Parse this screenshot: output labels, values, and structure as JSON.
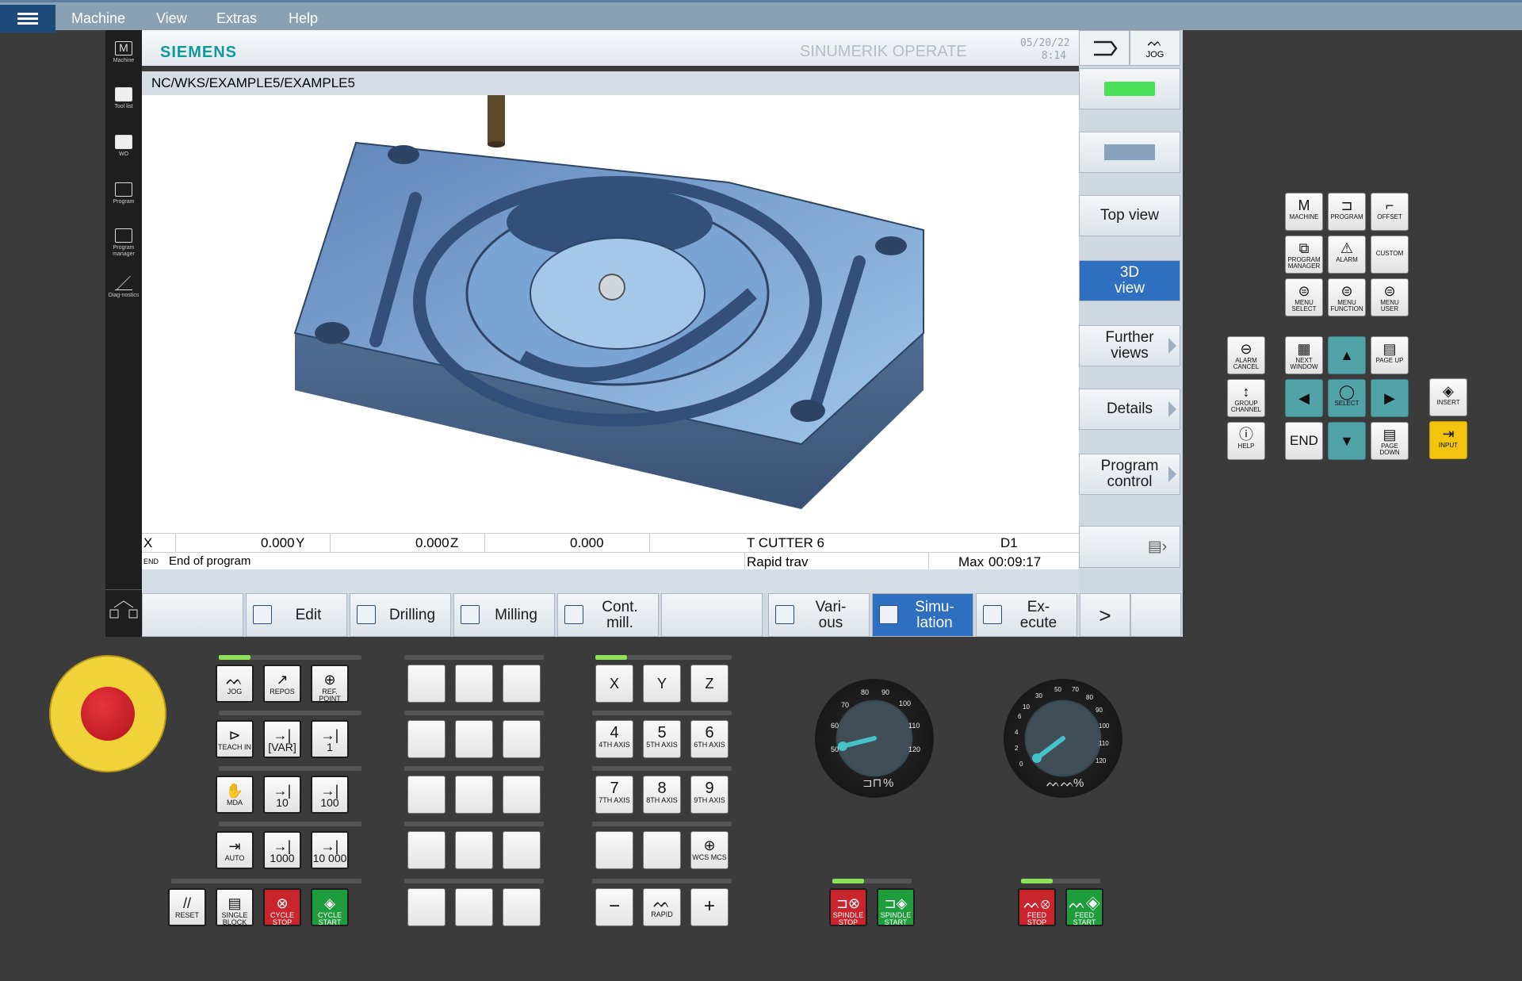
{
  "menu": {
    "items": [
      "Machine",
      "View",
      "Extras",
      "Help"
    ]
  },
  "left_strip": [
    {
      "label": "Machine",
      "icon": "machine-icon"
    },
    {
      "label": "Tool list",
      "icon": "tool-list-icon"
    },
    {
      "label": "WO",
      "icon": "work-offset-icon"
    },
    {
      "label": "Program",
      "icon": "program-icon"
    },
    {
      "label": "Program manager",
      "icon": "program-manager-icon"
    },
    {
      "label": "Diag-nostics",
      "icon": "diagnostics-icon"
    }
  ],
  "header": {
    "brand": "SIEMENS",
    "product": "SINUMERIK OPERATE",
    "date": "05/20/22",
    "time": "8:14",
    "mode_label": "JOG"
  },
  "path": "NC/WKS/EXAMPLE5/EXAMPLE5",
  "status": {
    "x_label": "X",
    "x_value": "0.000",
    "y_label": "Y",
    "y_value": "0.000",
    "z_label": "Z",
    "z_value": "0.000",
    "tool": "T CUTTER 6",
    "d": "D1",
    "end_flag": "END",
    "program_state": "End of program",
    "feed_mode": "Rapid trav",
    "max_label": "Max",
    "max_time": "00:09:17"
  },
  "right_softkeys": [
    {
      "label": "Top view"
    },
    {
      "label": "3D view",
      "active": true
    },
    {
      "label": "Further views",
      "arrow": true
    },
    {
      "label": "Details",
      "arrow": true
    },
    {
      "label": "Program control",
      "arrow": true
    }
  ],
  "bottom_softkeys": [
    {
      "label": ""
    },
    {
      "label": "Edit"
    },
    {
      "label": "Drilling"
    },
    {
      "label": "Milling"
    },
    {
      "label": "Cont. mill."
    },
    {
      "label": ""
    },
    {
      "label": "Vari- ous"
    },
    {
      "label": "Simu- lation",
      "active": true
    },
    {
      "label": "Ex- ecute"
    },
    {
      "label": ">"
    },
    {
      "label": ""
    }
  ],
  "mcp_left": [
    [
      {
        "label": "JOG",
        "glyph": "ᨓ"
      },
      {
        "label": "REPOS",
        "glyph": "↗"
      },
      {
        "label": "REF. POINT",
        "glyph": "⊕"
      }
    ],
    [
      {
        "label": "TEACH IN",
        "glyph": "⊳"
      },
      {
        "label": "[VAR]",
        "glyph": "→|"
      },
      {
        "label": "1",
        "glyph": "→|"
      }
    ],
    [
      {
        "label": "MDA",
        "glyph": "✋"
      },
      {
        "label": "10",
        "glyph": "→|"
      },
      {
        "label": "100",
        "glyph": "→|"
      }
    ],
    [
      {
        "label": "AUTO",
        "glyph": "⇥"
      },
      {
        "label": "1000",
        "glyph": "→|"
      },
      {
        "label": "10 000",
        "glyph": "→|"
      }
    ]
  ],
  "mcp_bottom": [
    {
      "label": "RESET",
      "glyph": "//"
    },
    {
      "label": "SINGLE BLOCK",
      "glyph": "▤"
    },
    {
      "label": "CYCLE STOP",
      "glyph": "⊗"
    },
    {
      "label": "CYCLE START",
      "glyph": "◈"
    }
  ],
  "axes": [
    [
      {
        "label": "X"
      },
      {
        "label": "Y"
      },
      {
        "label": "Z"
      }
    ],
    [
      {
        "num": "4",
        "label": "4TH AXIS"
      },
      {
        "num": "5",
        "label": "5TH AXIS"
      },
      {
        "num": "6",
        "label": "6TH AXIS"
      }
    ],
    [
      {
        "num": "7",
        "label": "7TH AXIS"
      },
      {
        "num": "8",
        "label": "8TH AXIS"
      },
      {
        "num": "9",
        "label": "9TH AXIS"
      }
    ],
    [
      {
        "label": ""
      },
      {
        "label": ""
      },
      {
        "label": "WCS MCS",
        "glyph": "⊕"
      }
    ],
    [
      {
        "label": "−"
      },
      {
        "label": "RAPID",
        "glyph": "ᨓ"
      },
      {
        "label": "+"
      }
    ]
  ],
  "spindle_override": {
    "ticks": [
      "50",
      "60",
      "70",
      "80",
      "90",
      "100",
      "110",
      "120"
    ],
    "value_pct": 50,
    "label": "%"
  },
  "feed_override": {
    "ticks": [
      "0",
      "2",
      "4",
      "6",
      "10",
      "30",
      "50",
      "70",
      "80",
      "90",
      "100",
      "110",
      "120"
    ],
    "value_pct": 0,
    "label": "%"
  },
  "spindle_keys": [
    {
      "label": "SPINDLE STOP"
    },
    {
      "label": "SPINDLE START"
    }
  ],
  "feed_keys": [
    {
      "label": "FEED STOP"
    },
    {
      "label": "FEED START"
    }
  ],
  "op_keys": {
    "top": [
      [
        {
          "label": "MACHINE",
          "glyph": "M"
        },
        {
          "label": "PROGRAM",
          "glyph": "⊐"
        },
        {
          "label": "OFFSET",
          "glyph": "⌐"
        }
      ],
      [
        {
          "label": "PROGRAM MANAGER",
          "glyph": "⧉"
        },
        {
          "label": "ALARM",
          "glyph": "⚠"
        },
        {
          "label": "CUSTOM",
          "glyph": ""
        }
      ],
      [
        {
          "label": "MENU SELECT",
          "glyph": "⊜"
        },
        {
          "label": "MENU FUNCTION",
          "glyph": "⊜"
        },
        {
          "label": "MENU USER",
          "glyph": "⊜"
        }
      ]
    ],
    "left": [
      {
        "label": "ALARM CANCEL",
        "glyph": "⊖"
      },
      {
        "label": "GROUP CHANNEL",
        "glyph": "↕"
      },
      {
        "label": "HELP",
        "glyph": "ⓘ"
      }
    ],
    "nav": [
      [
        {
          "label": "NEXT WINDOW",
          "glyph": "▦"
        },
        {
          "label": "",
          "glyph": "▲"
        },
        {
          "label": "PAGE UP",
          "glyph": "▤"
        }
      ],
      [
        {
          "label": "",
          "glyph": "◀"
        },
        {
          "label": "SELECT",
          "glyph": "◯"
        },
        {
          "label": "",
          "glyph": "▶"
        }
      ],
      [
        {
          "label": "END",
          "glyph": ""
        },
        {
          "label": "",
          "glyph": "▼"
        },
        {
          "label": "PAGE DOWN",
          "glyph": "▤"
        }
      ]
    ],
    "right": [
      {
        "label": "INSERT",
        "glyph": "◈"
      },
      {
        "label": "INPUT",
        "glyph": "⇥"
      }
    ]
  }
}
